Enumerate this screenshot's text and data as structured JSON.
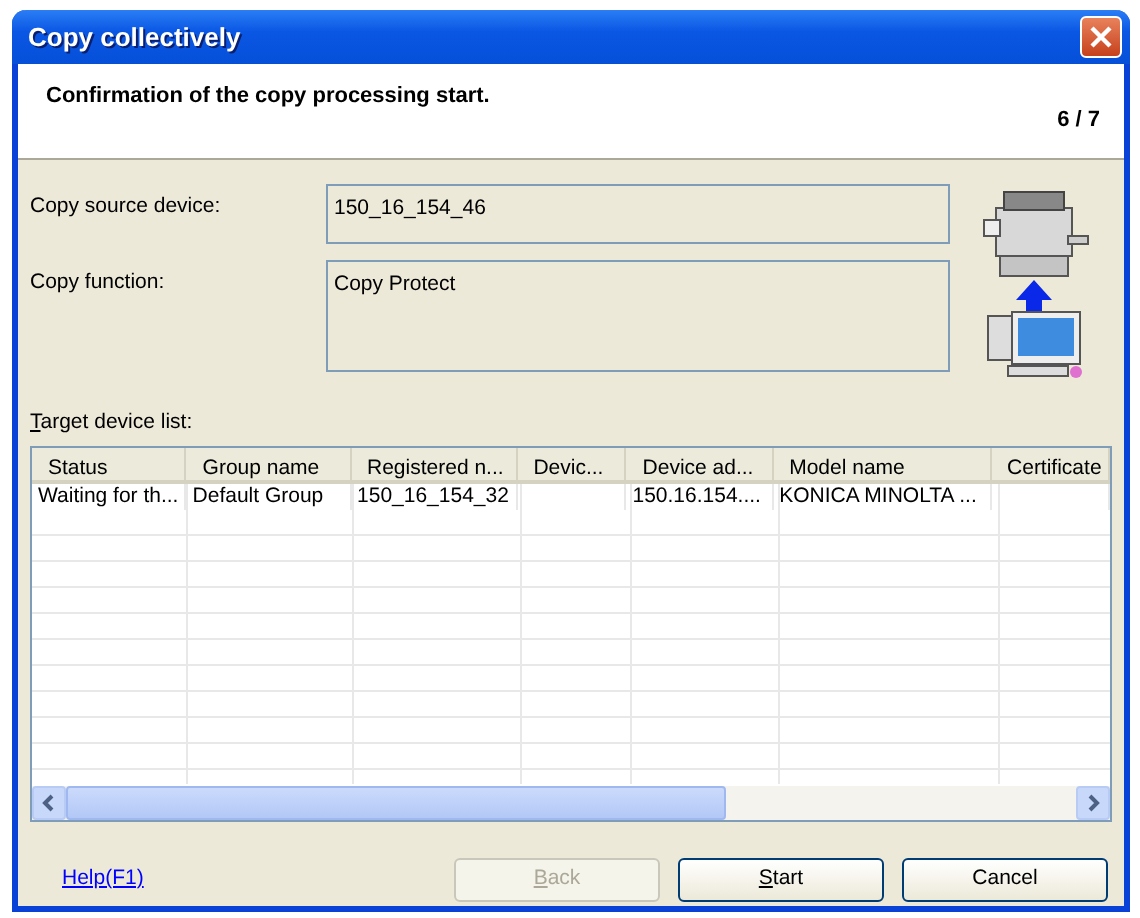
{
  "window": {
    "title": "Copy collectively"
  },
  "header": {
    "message": "Confirmation of the copy processing start.",
    "step": "6 / 7"
  },
  "fields": [
    {
      "label": "Copy source device:",
      "value": "150_16_154_46",
      "kind": "short"
    },
    {
      "label": "Copy function:",
      "value": "Copy Protect",
      "kind": "tall"
    }
  ],
  "target_list": {
    "label": "Target device list:",
    "columns": [
      "Status",
      "Group name",
      "Registered n...",
      "Devic...",
      "Device ad...",
      "Model name",
      "Certificate"
    ],
    "rows": [
      [
        "Waiting for th...",
        "Default Group",
        "150_16_154_32",
        "",
        "150.16.154....",
        "KONICA MINOLTA ...",
        ""
      ]
    ]
  },
  "help_link": "Help(F1)",
  "buttons": [
    {
      "label": "Back",
      "disabled": true
    },
    {
      "label": "Start",
      "disabled": false
    },
    {
      "label": "Cancel",
      "disabled": false
    }
  ]
}
